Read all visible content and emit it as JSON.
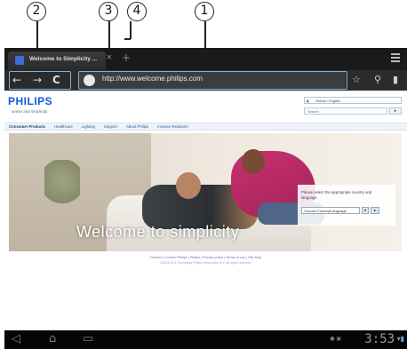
{
  "callouts": {
    "c1": "1",
    "c2": "2",
    "c3": "3",
    "c4": "4"
  },
  "tabstrip": {
    "tab_title": "Welcome to Simplicity ...",
    "tab_close_icon": "×",
    "new_tab_icon": "+"
  },
  "toolbar": {
    "back_icon": "←",
    "forward_icon": "→",
    "reload_icon": "C",
    "url": "http://www.welcome.philips.com",
    "bookmark_star_icon": "☆",
    "search_icon": "⚲",
    "bookmarks_icon": "▮"
  },
  "page": {
    "brand": "PHILIPS",
    "tagline": "sense and simplicity",
    "language": "Global / English",
    "search_placeholder": "Search",
    "search_go": "▸",
    "nav": [
      "Consumer Products",
      "Healthcare",
      "Lighting",
      "Support",
      "About Philips",
      "Investor Relations"
    ],
    "hero_title": "Welcome to simplicity",
    "country_prompt": "Please select the appropriate country and language",
    "country_select": "Choose Country/Language",
    "footer_links": "Careers | Contact Philips | Philips | Privacy policy | Terms of use | Site Map",
    "footer_copy": "©2004-2011 Koninklijke Philips Electronics N.V. All rights reserved."
  },
  "sysbar": {
    "back_icon": "◁",
    "home_icon": "⌂",
    "recent_icon": "▭",
    "clock": "3:53",
    "signal_icon": "▾▮"
  }
}
